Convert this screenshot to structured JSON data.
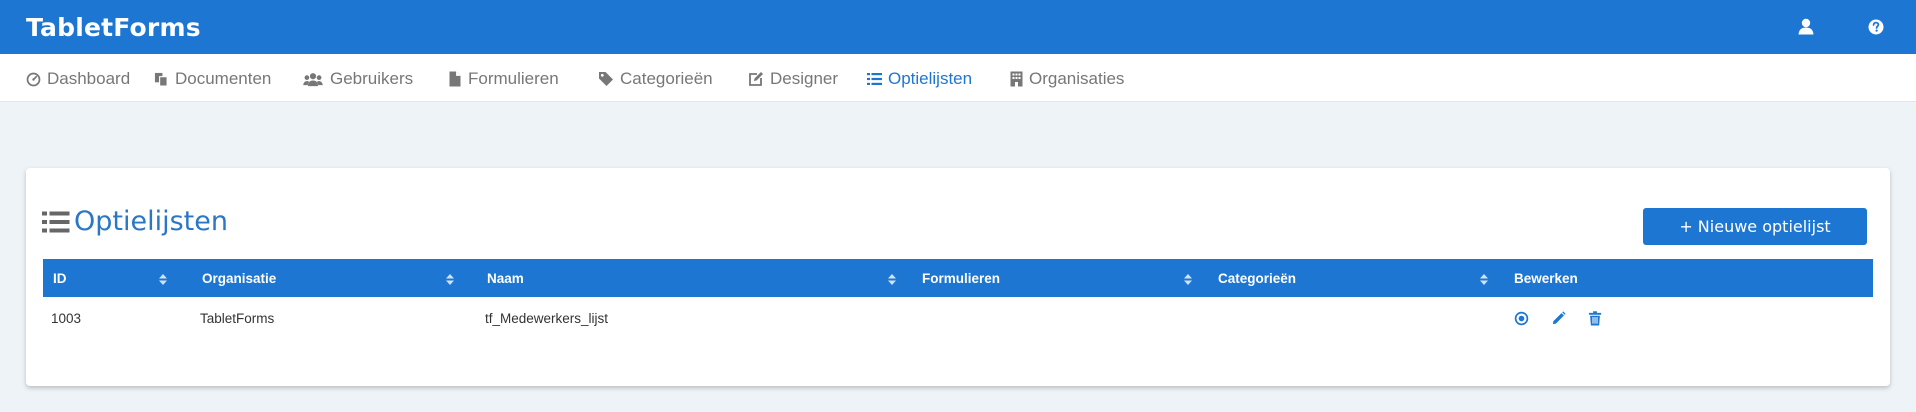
{
  "app": {
    "title": "TabletForms"
  },
  "topbar": {
    "user_icon": "user-icon",
    "help_icon": "help-icon"
  },
  "nav": {
    "items": [
      {
        "label": "Dashboard",
        "icon": "dashboard-icon"
      },
      {
        "label": "Documenten",
        "icon": "documents-icon"
      },
      {
        "label": "Gebruikers",
        "icon": "users-icon"
      },
      {
        "label": "Formulieren",
        "icon": "file-icon"
      },
      {
        "label": "Categorieën",
        "icon": "tag-icon"
      },
      {
        "label": "Designer",
        "icon": "edit-icon"
      },
      {
        "label": "Optielijsten",
        "icon": "list-icon",
        "active": true
      },
      {
        "label": "Organisaties",
        "icon": "building-icon"
      }
    ]
  },
  "page": {
    "title": "Optielijsten",
    "new_button": "+ Nieuwe optielijst"
  },
  "table": {
    "columns": [
      "ID",
      "Organisatie",
      "Naam",
      "Formulieren",
      "Categorieën",
      "Bewerken"
    ],
    "rows": [
      {
        "id": "1003",
        "organisatie": "TabletForms",
        "naam": "tf_Medewerkers_lijst",
        "formulieren": "",
        "categorieen": ""
      }
    ],
    "row_actions": [
      "view-icon",
      "pencil-icon",
      "trash-icon"
    ]
  },
  "colors": {
    "primary": "#1d76d2",
    "title": "#2a77c5",
    "background": "#edf3f7"
  }
}
